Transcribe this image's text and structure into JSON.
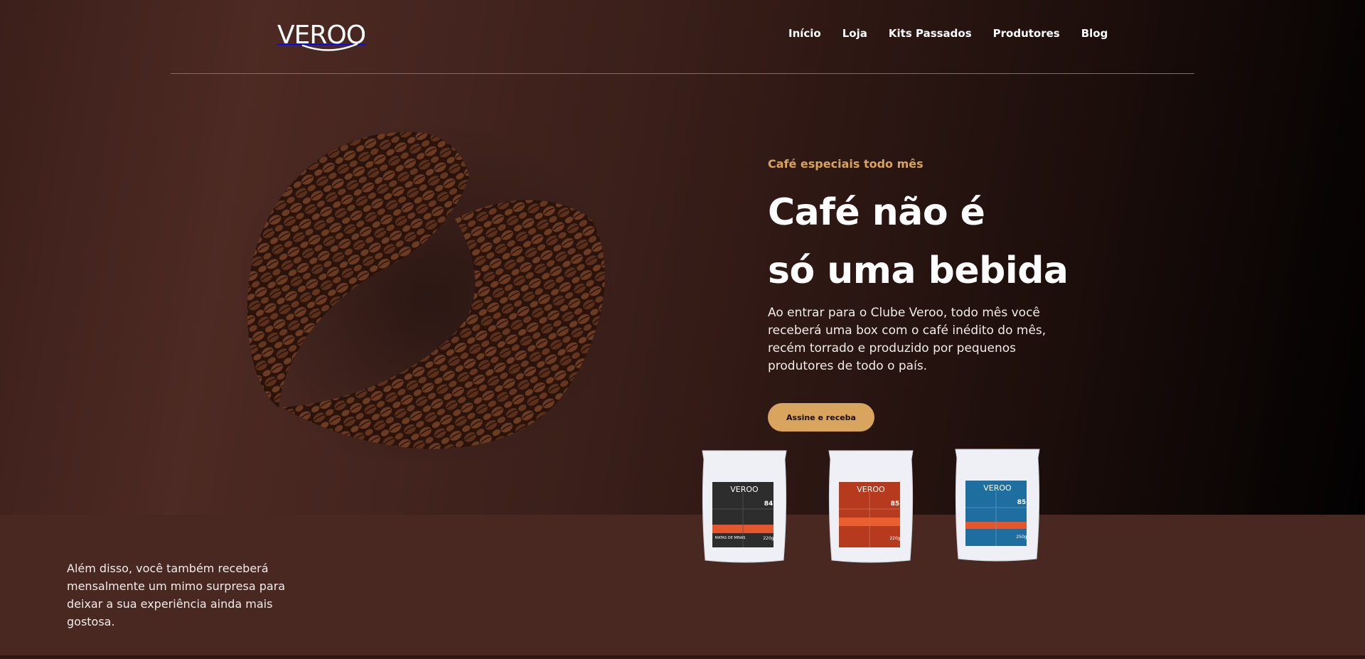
{
  "header": {
    "logo_text": "VEROO",
    "nav": [
      "Início",
      "Loja",
      "Kits Passados",
      "Produtores",
      "Blog"
    ]
  },
  "hero": {
    "eyebrow": "Café especiais todo mês",
    "headline_line1": "Café não é",
    "headline_line2": "só uma bebida",
    "lead": "Ao entrar para o Clube Veroo, todo mês você receberá uma box com o café inédito do mês, recém torrado e produzido por pequenos produtores de todo o país.",
    "cta_label": "Assine e receba"
  },
  "extra": {
    "text": "Além disso, você também receberá mensalmente um mimo surpresa para deixar a sua experiência ainda mais gostosa."
  },
  "bags": [
    {
      "logo": "VEROO",
      "score": "84",
      "region": "MATAS DE MINAS",
      "weight": "220g",
      "color": "#2d2d2d",
      "stripe": "#e4572e"
    },
    {
      "logo": "VEROO",
      "score": "85",
      "region": "",
      "weight": "220g",
      "color": "#b63a1e",
      "stripe": "#e8602f"
    },
    {
      "logo": "VEROO",
      "score": "85",
      "region": "",
      "weight": "250g",
      "color": "#1e6fa0",
      "stripe": "#e4572e"
    }
  ],
  "colors": {
    "accent": "#d8a45e",
    "background": "#4a2822",
    "text": "#ffffff"
  }
}
